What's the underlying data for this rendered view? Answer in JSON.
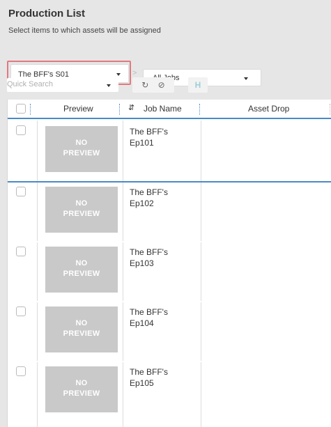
{
  "header": {
    "title": "Production List",
    "subtitle": "Select items to which assets will be assigned"
  },
  "filters": {
    "season_select": "The BFF's S01",
    "jobs_select": "All Jobs",
    "quick_search_placeholder": "Quick Search"
  },
  "toolbar": {
    "refresh_icon": "refresh-icon",
    "clear_icon": "block-icon",
    "collapse_icon": "collapse-icon"
  },
  "table": {
    "columns": {
      "preview": "Preview",
      "job_name": "Job Name",
      "asset_drop": "Asset Drop"
    },
    "no_preview_line1": "NO",
    "no_preview_line2": "PREVIEW",
    "rows": [
      {
        "name_line1": "The BFF's",
        "name_line2": "Ep101"
      },
      {
        "name_line1": "The BFF's",
        "name_line2": "Ep102"
      },
      {
        "name_line1": "The BFF's",
        "name_line2": "Ep103"
      },
      {
        "name_line1": "The BFF's",
        "name_line2": "Ep104"
      },
      {
        "name_line1": "The BFF's",
        "name_line2": "Ep105"
      }
    ]
  },
  "colors": {
    "highlight": "#e07a80",
    "header_accent": "#4a89c6",
    "no_preview_bg": "#c9c9c9"
  }
}
